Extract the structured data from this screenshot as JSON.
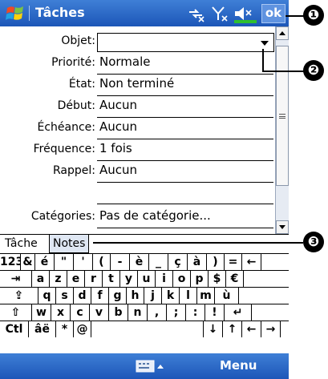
{
  "titlebar": {
    "title": "Tâches",
    "ok_label": "ok",
    "icons": [
      "windows-start-flag-icon",
      "connectivity-icon",
      "signal-off-icon",
      "volume-off-icon",
      "battery-icon"
    ]
  },
  "form": {
    "objet": {
      "label": "Objet:",
      "value": ""
    },
    "priorite": {
      "label": "Priorité:",
      "value": "Normale"
    },
    "etat": {
      "label": "État:",
      "value": "Non terminé"
    },
    "debut": {
      "label": "Début:",
      "value": "Aucun"
    },
    "echeance": {
      "label": "Échéance:",
      "value": "Aucun"
    },
    "frequence": {
      "label": "Fréquence:",
      "value": "1 fois"
    },
    "rappel": {
      "label": "Rappel:",
      "value": "Aucun"
    },
    "categories": {
      "label": "Catégories:",
      "value": "Pas de catégorie..."
    }
  },
  "tabs": {
    "tache": "Tâche",
    "notes": "Notes"
  },
  "keyboard": {
    "row1": [
      "123",
      "&",
      "é",
      "\"",
      "'",
      "(",
      "-",
      "è",
      "_",
      "ç",
      "à",
      ")",
      "=",
      "←"
    ],
    "row2": [
      "⇥",
      "a",
      "z",
      "e",
      "r",
      "t",
      "y",
      "u",
      "i",
      "o",
      "p",
      "$",
      "€"
    ],
    "row3": [
      "⇪",
      "q",
      "s",
      "d",
      "f",
      "g",
      "h",
      "j",
      "k",
      "l",
      "m",
      "ù"
    ],
    "row4": [
      "⇧",
      "w",
      "x",
      "c",
      "v",
      "b",
      "n",
      ",",
      ";",
      ":",
      "!",
      "↵"
    ],
    "row5": [
      "Ctl",
      "âë",
      "*",
      "@",
      "",
      "↓",
      "↑",
      "←",
      "→"
    ]
  },
  "menubar": {
    "menu_label": "Menu",
    "sip_icon": "keyboard-icon"
  },
  "callouts": [
    "❶",
    "❷",
    "❸"
  ],
  "colors": {
    "titlebar": "#1c56b8",
    "tab_active": "#dfe7f3",
    "battery": "#2fbf2f"
  }
}
